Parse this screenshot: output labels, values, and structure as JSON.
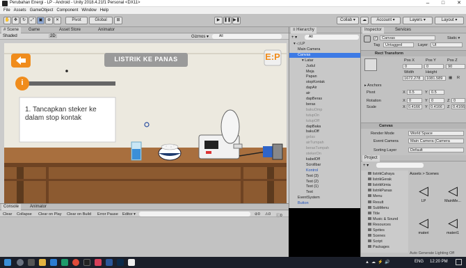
{
  "window": {
    "title": "Perubahan Energi - LP - Android - Unity 2018.4.21f1 Personal <DX11>",
    "controls": [
      "–",
      "□",
      "✕"
    ]
  },
  "menu": [
    "File",
    "Assets",
    "GameObject",
    "Component",
    "Window",
    "Help"
  ],
  "toolbar": {
    "pivot": "Pivot",
    "global": "Global",
    "collab": "Collab ▾",
    "account": "Account ▾",
    "layers": "Layers ▾",
    "layout": "Layout ▾"
  },
  "scene_tabs": {
    "scene": "# Scene",
    "game": "Game",
    "asset_store": "Asset Store",
    "animator": "Animator"
  },
  "scene_toolbar": {
    "shading": "Shaded",
    "mode": "2D",
    "gizmos": "Gizmos ▾",
    "search": "All"
  },
  "game": {
    "title": "LISTRIK KE PANAS",
    "badge": "E:P",
    "info_icon": "i",
    "instruction": "1. Tancapkan steker ke dalam stop kontak"
  },
  "hierarchy": {
    "tab": "≡ Hierarchy",
    "create": "+ ▾",
    "search": "All",
    "items": [
      {
        "label": "▾ ◁ LP",
        "indent": 0,
        "state": "normal"
      },
      {
        "label": "Main Camera",
        "indent": 1,
        "state": "normal"
      },
      {
        "label": "Canvas",
        "indent": 1,
        "state": "selected"
      },
      {
        "label": "▾ Latar",
        "indent": 2,
        "state": "normal"
      },
      {
        "label": "Judul",
        "indent": 3,
        "state": "normal"
      },
      {
        "label": "Meja",
        "indent": 3,
        "state": "normal"
      },
      {
        "label": "Papan",
        "indent": 3,
        "state": "normal"
      },
      {
        "label": "stopKontak",
        "indent": 3,
        "state": "normal"
      },
      {
        "label": "dapAir",
        "indent": 3,
        "state": "normal"
      },
      {
        "label": "air",
        "indent": 3,
        "state": "normal"
      },
      {
        "label": "dapBeras",
        "indent": 3,
        "state": "normal"
      },
      {
        "label": "beras",
        "indent": 3,
        "state": "normal"
      },
      {
        "label": "bakuOmp",
        "indent": 3,
        "state": "dim"
      },
      {
        "label": "tutupOn",
        "indent": 3,
        "state": "dim"
      },
      {
        "label": "tutupOff",
        "indent": 3,
        "state": "dim"
      },
      {
        "label": "dapBaka",
        "indent": 3,
        "state": "normal"
      },
      {
        "label": "bakuOff",
        "indent": 3,
        "state": "normal"
      },
      {
        "label": "gelas",
        "indent": 3,
        "state": "dim"
      },
      {
        "label": "airTumpah",
        "indent": 3,
        "state": "dim"
      },
      {
        "label": "berasTumpah",
        "indent": 3,
        "state": "dim"
      },
      {
        "label": "stekerOn",
        "indent": 3,
        "state": "dim"
      },
      {
        "label": "kabelOff",
        "indent": 3,
        "state": "normal"
      },
      {
        "label": "Scrollbar",
        "indent": 3,
        "state": "normal"
      },
      {
        "label": "Kontrol",
        "indent": 3,
        "state": "blue"
      },
      {
        "label": "Text (3)",
        "indent": 3,
        "state": "normal"
      },
      {
        "label": "Text (2)",
        "indent": 3,
        "state": "normal"
      },
      {
        "label": "Text (1)",
        "indent": 3,
        "state": "normal"
      },
      {
        "label": "Text",
        "indent": 3,
        "state": "normal"
      },
      {
        "label": "EventSystem",
        "indent": 1,
        "state": "normal"
      },
      {
        "label": "Button",
        "indent": 1,
        "state": "blue"
      }
    ]
  },
  "inspector": {
    "tab": "Inspector",
    "services_tab": "Services",
    "object_name": "Canvas",
    "static_label": "Static ▾",
    "tag_label": "Tag",
    "tag_value": "Untagged",
    "layer_label": "Layer",
    "layer_value": "UI",
    "rect_transform": {
      "title": "Rect Transform",
      "pos_x_label": "Pos X",
      "pos_y_label": "Pos Y",
      "pos_z_label": "Pos Z",
      "pos_x": "0",
      "pos_y": "0",
      "pos_z": "90",
      "width_label": "Width",
      "height_label": "Height",
      "width": "1672.278",
      "height": "1081.589",
      "anchors": "▸ Anchors",
      "pivot_label": "Pivot",
      "pivot_x": "0.5",
      "pivot_y": "0.5",
      "rotation_label": "Rotation",
      "rot_x": "0",
      "rot_y": "0",
      "rot_z": "0",
      "scale_label": "Scale",
      "scale_x": "0.4166",
      "scale_y": "0.4166",
      "scale_z": "0.4166"
    },
    "canvas": {
      "title": "Canvas",
      "render_mode_label": "Render Mode",
      "render_mode": "World Space",
      "event_camera_label": "Event Camera",
      "event_camera": "Main Camera (Camera",
      "sorting_layer_label": "Sorting Layer",
      "sorting_layer": "Default"
    }
  },
  "project": {
    "tab": "Project",
    "create": "+ ▾",
    "breadcrumb": "Assets > Scenes",
    "tree": [
      "listrikCahaya",
      "listrikGerak",
      "listrikKimia",
      "listrikPanas",
      "Menu",
      "Result",
      "SubMenu",
      "Title",
      "Music & Sound",
      "Resources",
      "Sprites",
      "Scenes",
      "Script",
      "Packages"
    ],
    "files": [
      "LP",
      "MainMe...",
      "materi",
      "materi1"
    ],
    "status": "Auto Generate Lighting Off"
  },
  "console": {
    "tab": "Console",
    "animator_tab": "Animator",
    "toolbar": [
      "Clear",
      "Collapse",
      "Clear on Play",
      "Clear on Build",
      "Error Pause",
      "Editor ▾"
    ],
    "counts": [
      "0",
      "0",
      "0"
    ]
  },
  "taskbar": {
    "time": "12:20 PM",
    "lang": "ENG"
  },
  "colors": {
    "accent": "#3d7ae5",
    "orange": "#f08c1c",
    "wood": "#a0683a",
    "wall": "#ece9df"
  }
}
